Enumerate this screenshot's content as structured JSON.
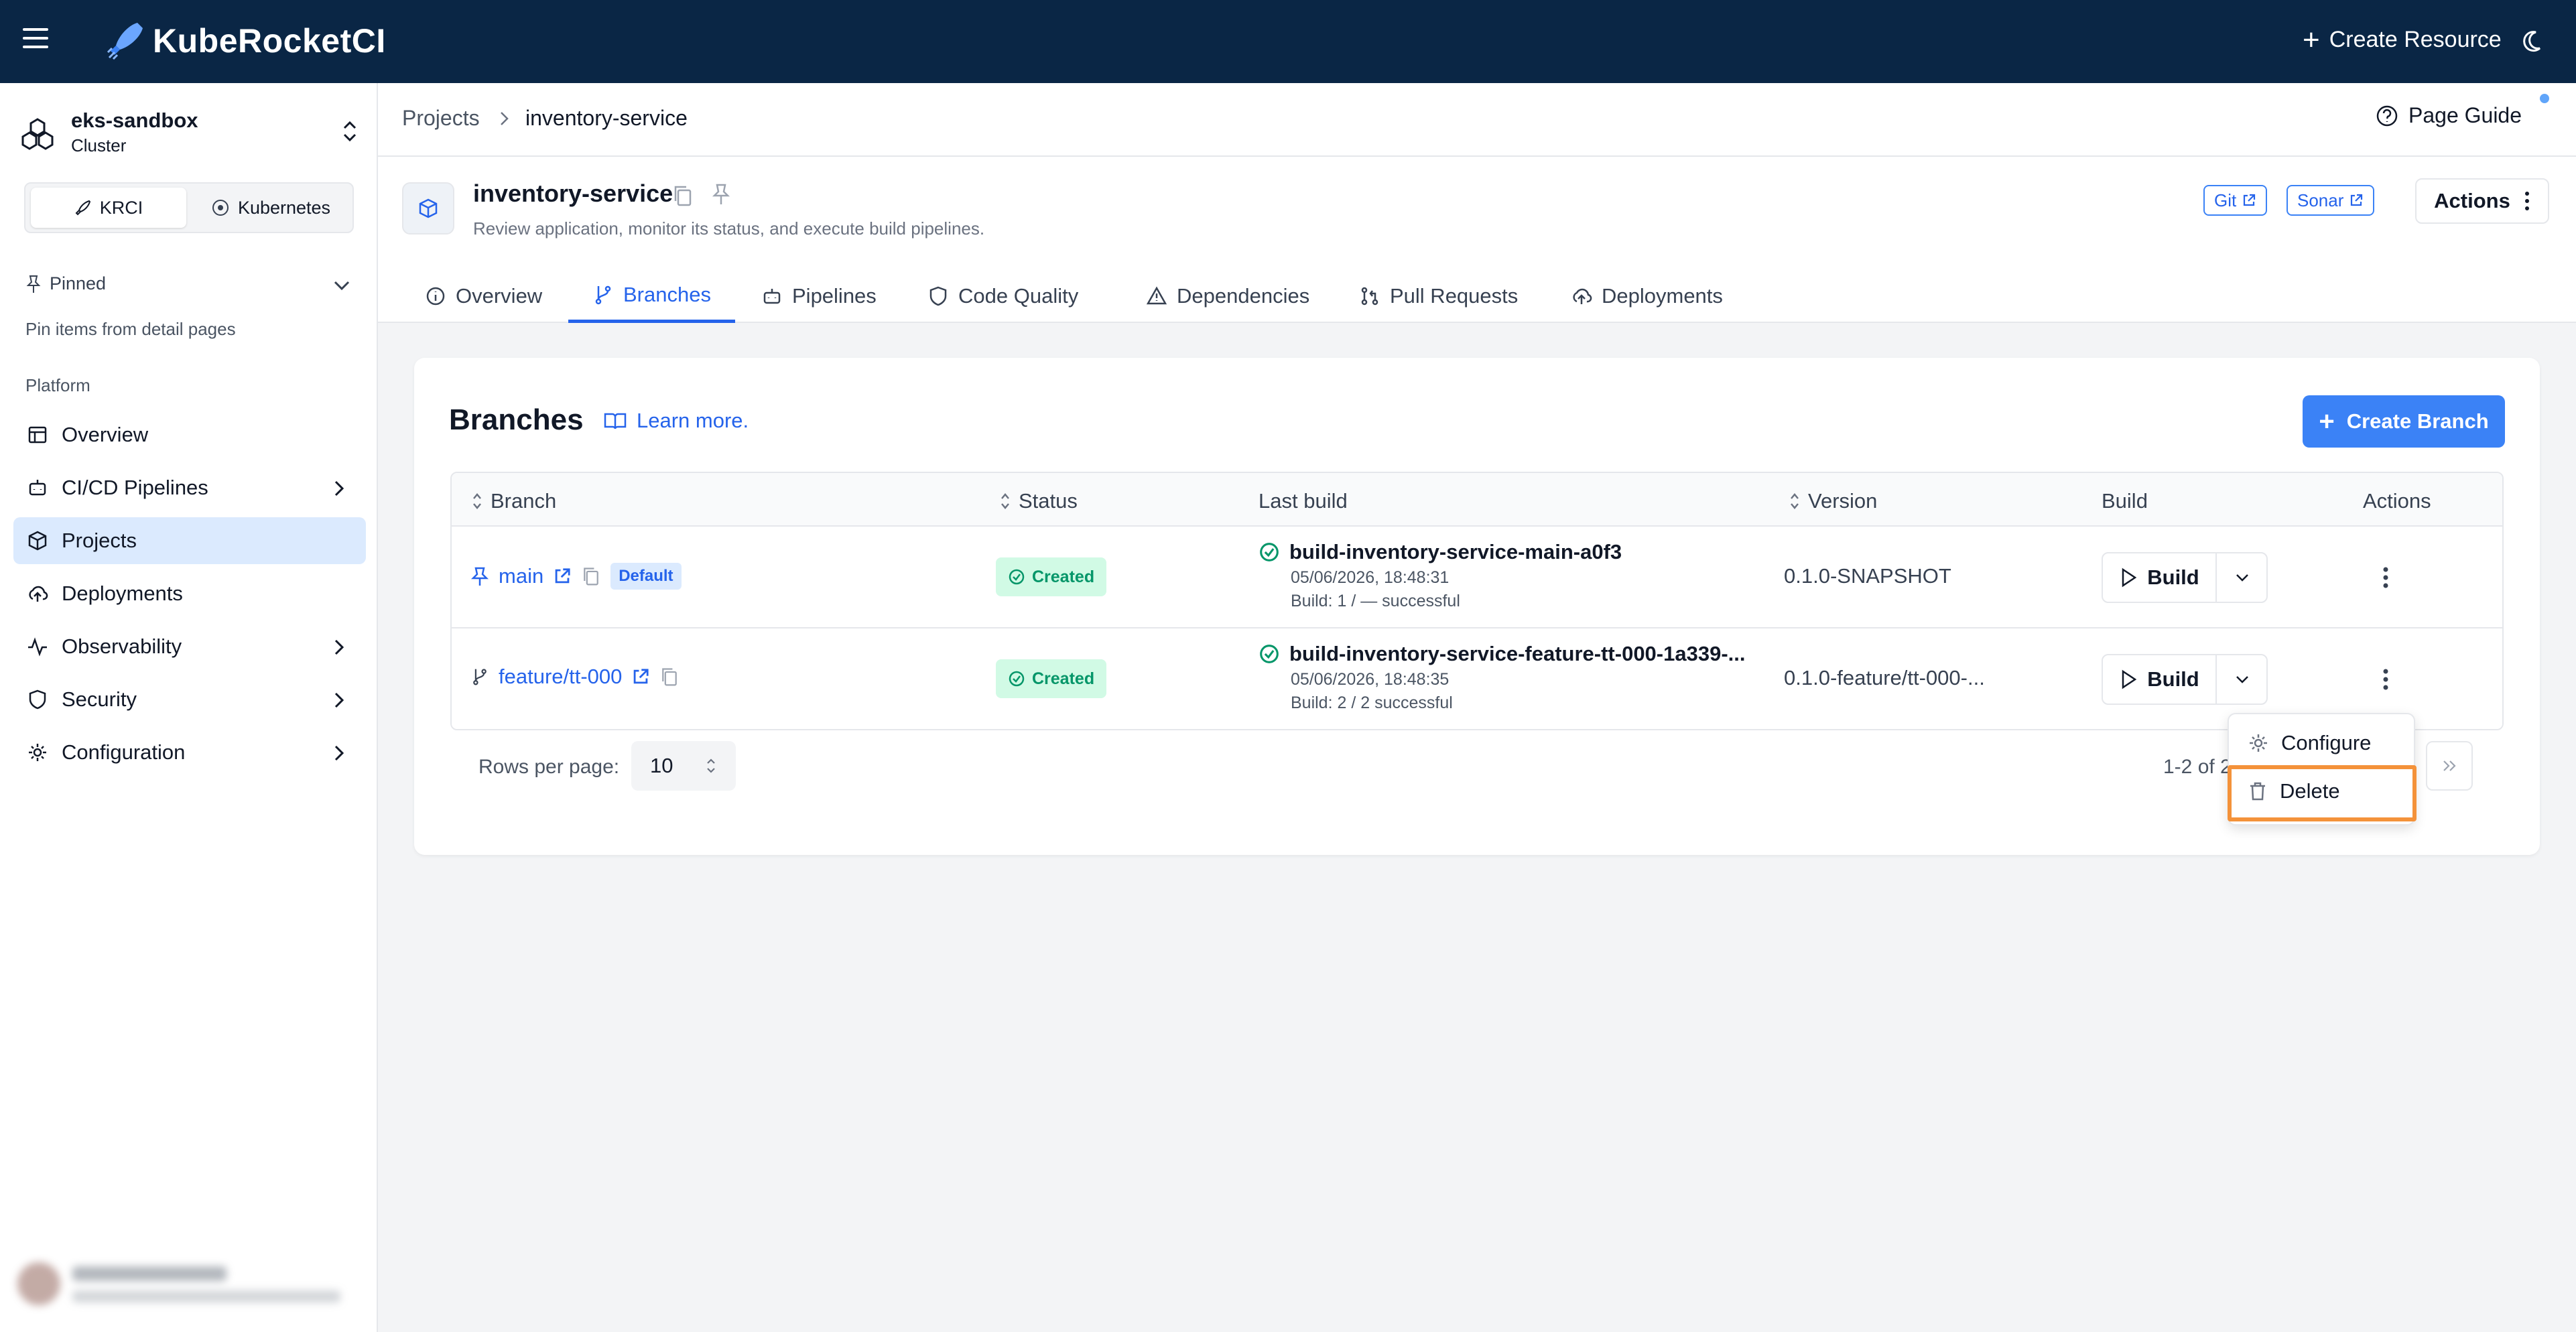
{
  "app": {
    "brand": "KubeRocketCI",
    "create_resource": "Create Resource"
  },
  "sidebar": {
    "cluster_name": "eks-sandbox",
    "cluster_sub": "Cluster",
    "segments": [
      "KRCI",
      "Kubernetes"
    ],
    "pinned_label": "Pinned",
    "pinned_hint": "Pin items from detail pages",
    "section_label": "Platform",
    "items": [
      {
        "label": "Overview",
        "icon": "table-icon"
      },
      {
        "label": "CI/CD Pipelines",
        "icon": "robot-icon"
      },
      {
        "label": "Projects",
        "icon": "cube-icon"
      },
      {
        "label": "Deployments",
        "icon": "cloud-upload-icon"
      },
      {
        "label": "Observability",
        "icon": "activity-icon"
      },
      {
        "label": "Security",
        "icon": "shield-icon"
      },
      {
        "label": "Configuration",
        "icon": "gear-icon"
      }
    ]
  },
  "breadcrumb": {
    "root": "Projects",
    "current": "inventory-service",
    "page_guide": "Page Guide"
  },
  "project": {
    "title": "inventory-service",
    "description": "Review application, monitor its status, and execute build pipelines.",
    "git_label": "Git",
    "sonar_label": "Sonar",
    "actions_label": "Actions"
  },
  "tabs": [
    {
      "label": "Overview",
      "icon": "info-icon"
    },
    {
      "label": "Branches",
      "icon": "git-branch-icon"
    },
    {
      "label": "Pipelines",
      "icon": "robot-icon"
    },
    {
      "label": "Code Quality",
      "icon": "shield-icon"
    },
    {
      "label": "Dependencies",
      "icon": "warning-icon"
    },
    {
      "label": "Pull Requests",
      "icon": "pull-request-icon"
    },
    {
      "label": "Deployments",
      "icon": "cloud-upload-icon"
    }
  ],
  "branches": {
    "title": "Branches",
    "learn_more": "Learn more.",
    "create_branch": "Create Branch",
    "columns": [
      "Branch",
      "Status",
      "Last build",
      "Version",
      "Build",
      "Actions"
    ],
    "rows": [
      {
        "branch": "main",
        "default_badge": "Default",
        "status": "Created",
        "build_name": "build-inventory-service-main-a0f3",
        "build_time": "05/06/2026, 18:48:31",
        "build_result": "Build: 1 / — successful",
        "version": "0.1.0-SNAPSHOT",
        "build_label": "Build"
      },
      {
        "branch": "feature/tt-000",
        "status": "Created",
        "build_name": "build-inventory-service-feature-tt-000-1a339-...",
        "build_time": "05/06/2026, 18:48:35",
        "build_result": "Build: 2 / 2 successful",
        "version": "0.1.0-feature/tt-000-...",
        "build_label": "Build"
      }
    ],
    "rows_per_page_label": "Rows per page:",
    "rows_per_page": "10",
    "pager_text": "1-2 of 2"
  },
  "menu": {
    "configure": "Configure",
    "delete": "Delete"
  },
  "colors": {
    "topbar": "#0a2645",
    "accent": "#3b82f6",
    "status_green": "#059669",
    "highlight": "#f4923a"
  }
}
